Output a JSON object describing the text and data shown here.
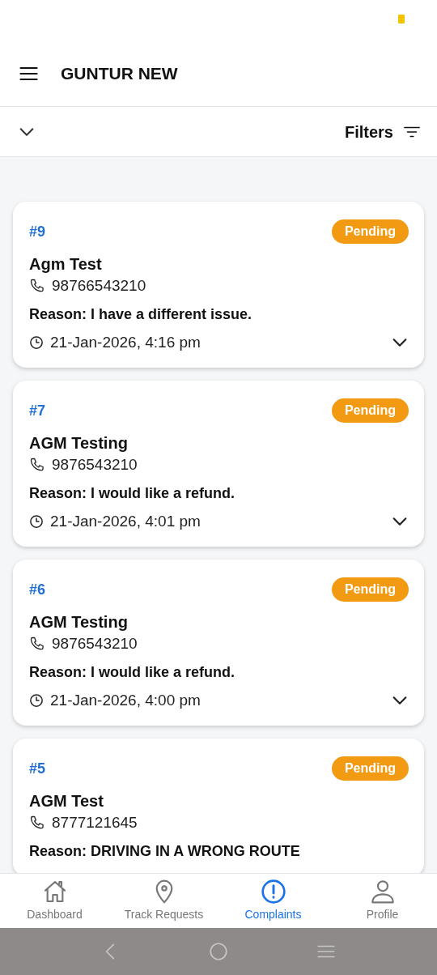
{
  "header": {
    "title": "GUNTUR NEW"
  },
  "filter_bar": {
    "label": "Filters"
  },
  "complaints": [
    {
      "number": "#9",
      "status": "Pending",
      "name": "Agm Test",
      "phone": "98766543210",
      "reason": "Reason: I have a different issue.",
      "time": "21-Jan-2026, 4:16 pm"
    },
    {
      "number": "#7",
      "status": "Pending",
      "name": "AGM Testing",
      "phone": "9876543210",
      "reason": "Reason: I would like a refund.",
      "time": "21-Jan-2026, 4:01 pm"
    },
    {
      "number": "#6",
      "status": "Pending",
      "name": "AGM Testing",
      "phone": "9876543210",
      "reason": "Reason: I would like a refund.",
      "time": "21-Jan-2026, 4:00 pm"
    },
    {
      "number": "#5",
      "status": "Pending",
      "name": "AGM Test",
      "phone": "8777121645",
      "reason": "Reason: DRIVING IN A WRONG ROUTE"
    }
  ],
  "bottom_nav": [
    {
      "label": "Dashboard",
      "selected": false
    },
    {
      "label": "Track Requests",
      "selected": false
    },
    {
      "label": "Complaints",
      "selected": true
    },
    {
      "label": "Profile",
      "selected": false
    }
  ]
}
